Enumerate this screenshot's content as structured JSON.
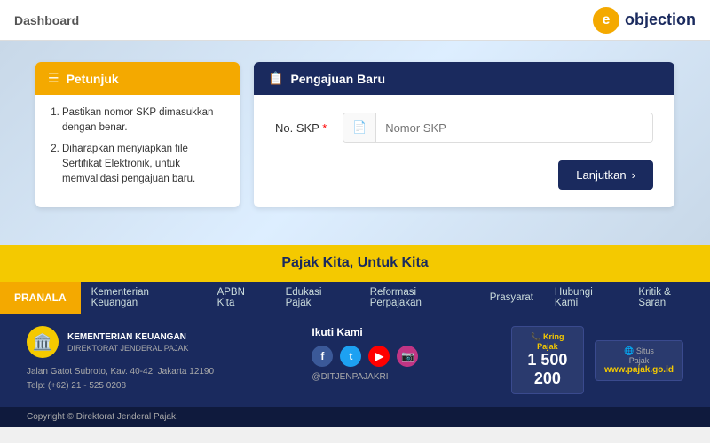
{
  "header": {
    "title": "Dashboard",
    "logo": {
      "icon_letter": "e",
      "brand_name": "objection"
    }
  },
  "petunjuk": {
    "title": "Petunjuk",
    "items": [
      "Pastikan nomor SKP dimasukkan dengan benar.",
      "Diharapkan menyiapkan file Sertifikat Elektronik, untuk memvalidasi pengajuan baru."
    ]
  },
  "pengajuan": {
    "title": "Pengajuan Baru",
    "form": {
      "label": "No. SKP",
      "placeholder": "Nomor SKP",
      "required": true
    },
    "button": {
      "label": "Lanjutkan",
      "chevron": "›"
    }
  },
  "yellow_banner": {
    "text": "Pajak Kita, Untuk Kita"
  },
  "navbar": {
    "pranala": "PRANALA",
    "items": [
      "Kementerian Keuangan",
      "APBN Kita",
      "Edukasi Pajak",
      "Reformasi Perpajakan",
      "Prasyarat",
      "Hubungi Kami",
      "Kritik & Saran"
    ]
  },
  "footer": {
    "org_name": "KEMENTERIAN KEUANGAN",
    "org_sub": "DIREKTORAT JENDERAL PAJAK",
    "address_line1": "Jalan Gatot Subroto, Kav. 40-42, Jakarta 12190",
    "address_line2": "Telp: (+62) 21 - 525 0208",
    "social_title": "Ikuti Kami",
    "social_handle": "@DITJENPAJAKRI",
    "kring_title": "Kring\nPajak",
    "kring_number": "1 500 200",
    "situs_title": "Situs\nPajak",
    "situs_url": "www.pajak.go.id",
    "copyright": "Copyright © Direktorat Jenderal Pajak."
  }
}
